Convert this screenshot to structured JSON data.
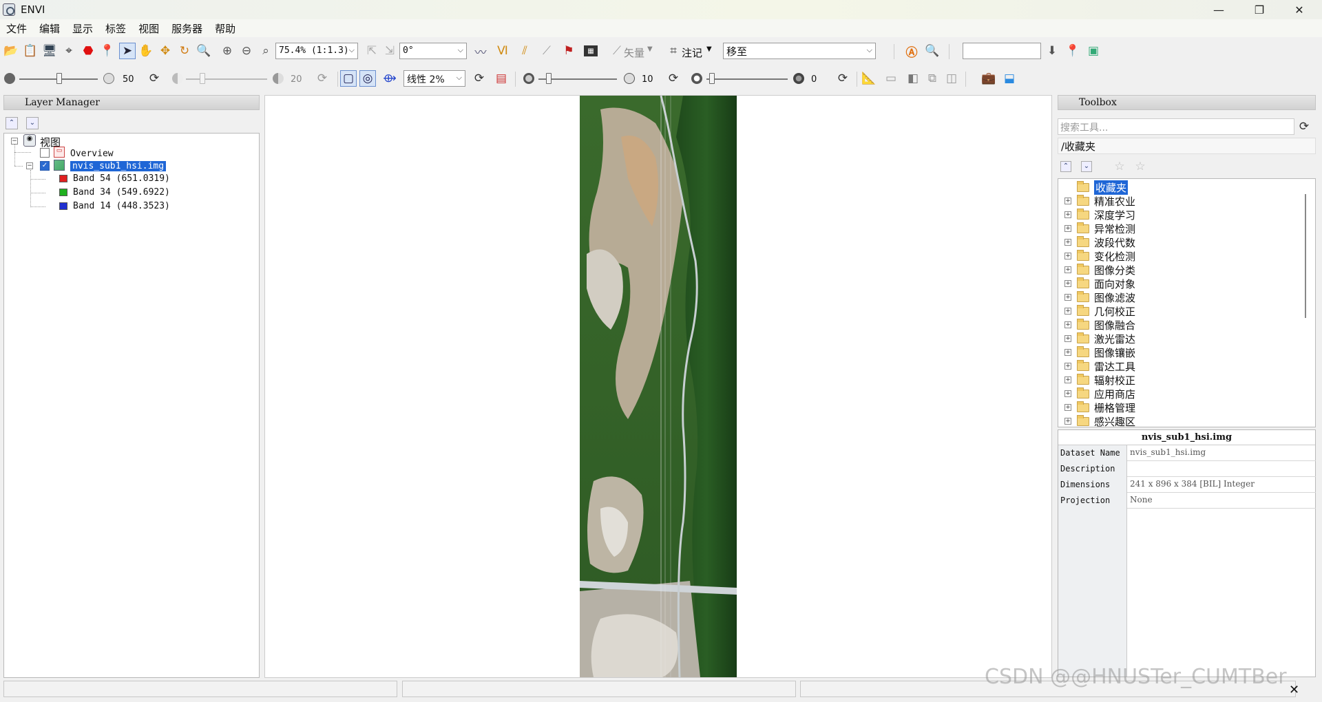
{
  "window": {
    "title": "ENVI",
    "minimize": "—",
    "restore": "❐",
    "close": "✕"
  },
  "menu": [
    "文件",
    "编辑",
    "显示",
    "标签",
    "视图",
    "服务器",
    "帮助"
  ],
  "toolbar1": {
    "zoom_value": "75.4% (1:1.3)",
    "rotation_value": "0°",
    "vector_label": "矢量",
    "annotation_label": "注记",
    "goto_value": "移至",
    "search_value": ""
  },
  "toolbar2": {
    "brightness_value": "50",
    "contrast_value": "20",
    "stretch_value": "线性 2%",
    "sharpen_value": "10",
    "transparency_value": "0"
  },
  "layer_manager": {
    "title": "Layer Manager",
    "root": "视图",
    "overview": "Overview",
    "file": "nvis_sub1_hsi.img",
    "bands": [
      {
        "label": "Band 54 (651.0319)",
        "color": "#e02020"
      },
      {
        "label": "Band 34 (549.6922)",
        "color": "#20b020"
      },
      {
        "label": "Band 14 (448.3523)",
        "color": "#2030d0"
      }
    ]
  },
  "toolbox": {
    "title": "Toolbox",
    "search_placeholder": "搜索工具...",
    "path": "/收藏夹",
    "folders": [
      "收藏夹",
      "精准农业",
      "深度学习",
      "异常检测",
      "波段代数",
      "变化检测",
      "图像分类",
      "面向对象",
      "图像滤波",
      "几何校正",
      "图像融合",
      "激光雷达",
      "图像镶嵌",
      "雷达工具",
      "辐射校正",
      "应用商店",
      "栅格管理",
      "感兴趣区"
    ]
  },
  "properties": {
    "header": "nvis_sub1_hsi.img",
    "rows": [
      {
        "key": "Dataset Name",
        "value": "nvis_sub1_hsi.img"
      },
      {
        "key": "Description",
        "value": ""
      },
      {
        "key": "Dimensions",
        "value": "241 x 896 x 384 [BIL] Integer"
      },
      {
        "key": "Projection",
        "value": "None"
      }
    ]
  },
  "watermark": "CSDN @@HNUSTer_CUMTBer"
}
